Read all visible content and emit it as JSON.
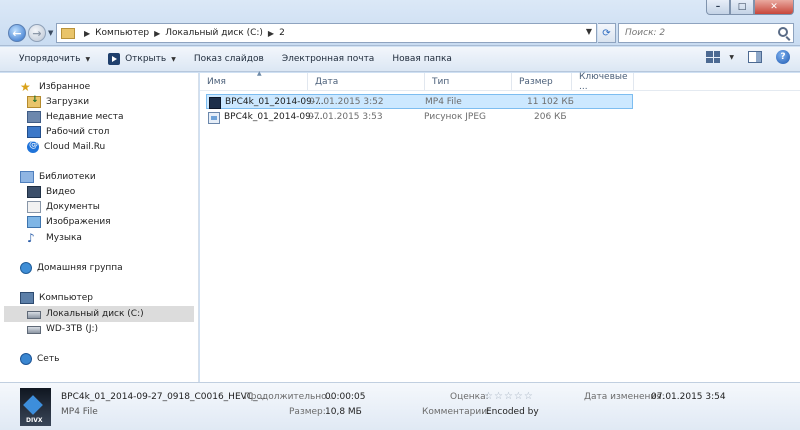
{
  "address": {
    "crumbs": [
      "Компьютер",
      "Локальный диск (C:)",
      "2"
    ]
  },
  "search": {
    "placeholder": "Поиск: 2"
  },
  "toolbar": {
    "organize": "Упорядочить",
    "open": "Открыть",
    "slideshow": "Показ слайдов",
    "email": "Электронная почта",
    "new_folder": "Новая папка"
  },
  "sidebar": {
    "favorites": "Избранное",
    "downloads": "Загрузки",
    "recent": "Недавние места",
    "desktop": "Рабочий стол",
    "cloud": "Cloud Mail.Ru",
    "libraries": "Библиотеки",
    "video": "Видео",
    "documents": "Документы",
    "images": "Изображения",
    "music": "Музыка",
    "homegroup": "Домашняя группа",
    "computer": "Компьютер",
    "drive_c": "Локальный диск (C:)",
    "drive_j": "WD-3TB (J:)",
    "network": "Сеть"
  },
  "columns": {
    "name": "Имя",
    "date": "Дата",
    "type": "Тип",
    "size": "Размер",
    "tags": "Ключевые ..."
  },
  "files": [
    {
      "name": "BPC4k_01_2014-09-...",
      "date": "07.01.2015 3:52",
      "type": "MP4 File",
      "size": "11 102 КБ"
    },
    {
      "name": "BPC4k_01_2014-09-...",
      "date": "07.01.2015 3:53",
      "type": "Рисунок JPEG",
      "size": "206 КБ"
    }
  ],
  "details": {
    "name": "BPC4k_01_2014-09-27_0918_C0016_HEVC_...",
    "type": "MP4 File",
    "duration_label": "Продолжительно...",
    "duration_value": "00:00:05",
    "size_label": "Размер:",
    "size_value": "10,8 МБ",
    "rating_label": "Оценка:",
    "comments_label": "Комментарии:",
    "comments_value": "Encoded by",
    "modified_label": "Дата изменения:",
    "modified_value": "07.01.2015 3:54",
    "thumb_label": "DIVX"
  },
  "colors": {
    "selection": "#cce8ff",
    "selection_border": "#7dbdf0",
    "accent": "#2d6ec8"
  }
}
